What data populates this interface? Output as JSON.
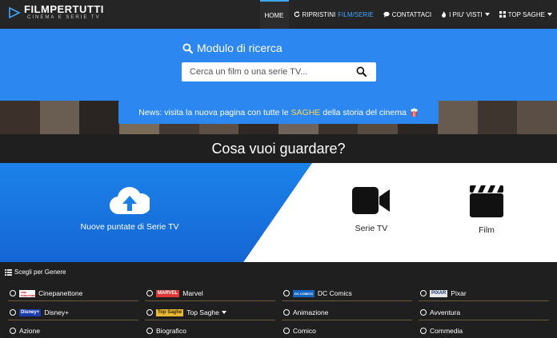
{
  "header": {
    "logo_title": "FILMPERTUTTI",
    "logo_subtitle": "CINEMA E SERIE TV",
    "nav": {
      "home": "HOME",
      "ripristini": "RIPRISTINI",
      "film_serie": "FILM/SERIE",
      "contattaci": "CONTATTACI",
      "piu_visti": "I PIU' VISTI",
      "top_saghe": "TOP SAGHE"
    }
  },
  "search": {
    "title": "Modulo di ricerca",
    "placeholder": "Cerca un film o una serie TV..."
  },
  "news": {
    "prefix": "News: visita la nuova pagina con tutte le",
    "highlight": "SAGHE",
    "suffix": "della storia del cinema"
  },
  "main": {
    "heading": "Cosa vuoi guardare?",
    "choices": {
      "nuove_puntate": "Nuove puntate di Serie TV",
      "serie_tv": "Serie TV",
      "film": "Film"
    }
  },
  "genres": {
    "heading": "Scegli per Genere",
    "items": {
      "cinepanettone": "Cinepanettone",
      "marvel": "Marvel",
      "dc": "DC Comics",
      "pixar": "Pixar",
      "disney": "Disney+",
      "top_saghe": "Top Saghe",
      "animazione": "Animazione",
      "avventura": "Avventura",
      "azione": "Azione",
      "biografico": "Biografico",
      "comico": "Comico",
      "commedia": "Commedia"
    },
    "badges": {
      "cinepanettone": "CINE PANETTONE",
      "marvel": "MARVEL",
      "dc": "DC COMICS",
      "pixar": "PIXAR",
      "disney": "Disney+",
      "top_saghe": "Top Saghe"
    }
  },
  "colors": {
    "accent": "#2d87f0",
    "nav_highlight": "#3ea6ff",
    "saghe": "#ffd54a",
    "background": "#1f1f1f"
  }
}
